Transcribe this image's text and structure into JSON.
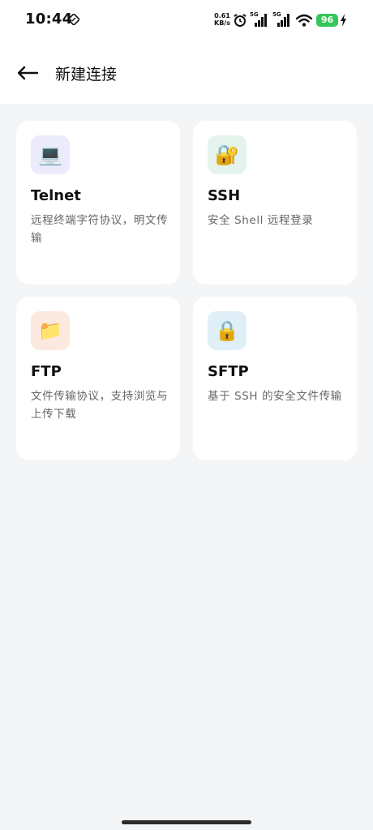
{
  "status_bar": {
    "time": "10:44",
    "net_speed_value": "0.61",
    "net_speed_unit": "KB/s",
    "sim1_label": "5G",
    "sim2_label": "5G",
    "battery_level": "96",
    "icons": [
      "nfc-icon",
      "alarm-icon",
      "signal-icon",
      "signal-icon",
      "wifi-icon",
      "charging-icon"
    ]
  },
  "app_bar": {
    "title": "新建连接",
    "back_icon": "arrow-left-icon"
  },
  "protocols": [
    {
      "name": "Telnet",
      "description": "远程终端字符协议，明文传输",
      "icon": "laptop-icon",
      "glyph": "💻",
      "icon_bg": "#ecebfb"
    },
    {
      "name": "SSH",
      "description": "安全 Shell 远程登录",
      "icon": "lock-with-key-icon",
      "glyph": "🔐",
      "icon_bg": "#e4f3ec"
    },
    {
      "name": "FTP",
      "description": "文件传输协议，支持浏览与上传下载",
      "icon": "folder-icon",
      "glyph": "📁",
      "icon_bg": "#fbe9df"
    },
    {
      "name": "SFTP",
      "description": "基于 SSH 的安全文件传输",
      "icon": "lock-icon",
      "glyph": "🔒",
      "icon_bg": "#e0eff7"
    }
  ],
  "colors": {
    "background": "#f4f5f7",
    "card": "#ffffff",
    "battery": "#34c759"
  }
}
